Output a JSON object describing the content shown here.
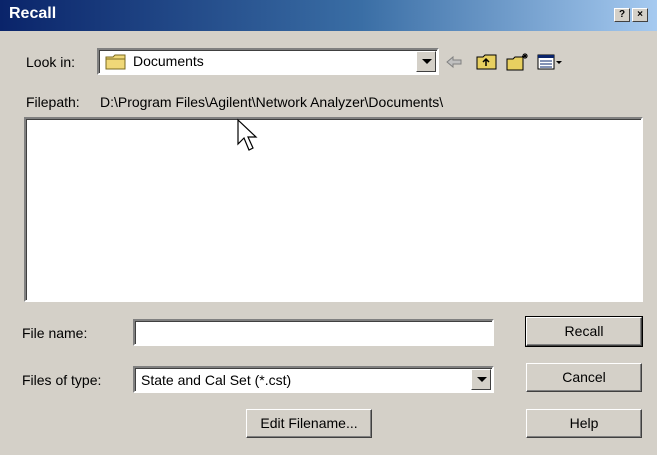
{
  "window": {
    "title": "Recall"
  },
  "title_buttons": {
    "help": "?",
    "close": "×"
  },
  "look_in": {
    "label": "Look in:",
    "value": "Documents"
  },
  "toolbar_icons": [
    "back-arrow-icon",
    "up-folder-icon",
    "new-folder-icon",
    "view-menu-icon"
  ],
  "filepath": {
    "label": "Filepath:",
    "value": "D:\\Program Files\\Agilent\\Network Analyzer\\Documents\\"
  },
  "file_list": {
    "items": []
  },
  "file_name": {
    "label": "File name:",
    "value": ""
  },
  "files_of_type": {
    "label": "Files of type:",
    "value": "State and Cal Set (*.cst)"
  },
  "buttons": {
    "recall": "Recall",
    "cancel": "Cancel",
    "help": "Help",
    "edit_filename": "Edit Filename..."
  }
}
